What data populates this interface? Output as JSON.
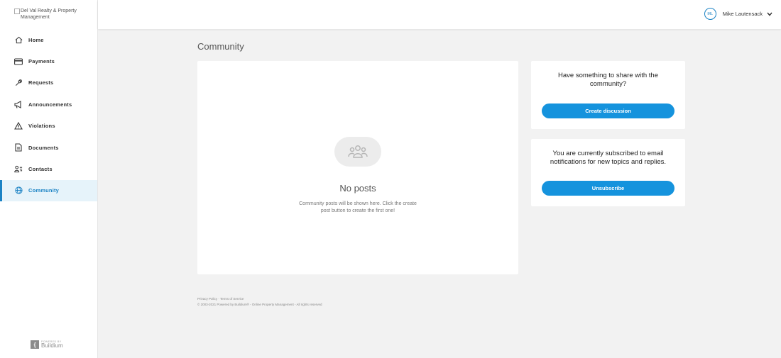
{
  "sidebar": {
    "logo_alt": "Del Val Realty & Property Management",
    "items": [
      {
        "label": "Home"
      },
      {
        "label": "Payments"
      },
      {
        "label": "Requests"
      },
      {
        "label": "Announcements"
      },
      {
        "label": "Violations"
      },
      {
        "label": "Documents"
      },
      {
        "label": "Contacts"
      },
      {
        "label": "Community",
        "active": true
      }
    ],
    "powered_small": "POWERED BY",
    "powered_brand": "Buildium"
  },
  "header": {
    "user_initials": "ML",
    "user_name": "Mike Lautensack"
  },
  "main": {
    "title": "Community",
    "empty_title": "No posts",
    "empty_desc": "Community posts will be shown here. Click the create post button to create the first one!"
  },
  "share_card": {
    "message": "Have something to share with the community?",
    "button": "Create discussion"
  },
  "subscribe_card": {
    "message": "You are currently subscribed to email notifications for new topics and replies.",
    "button": "Unsubscribe"
  },
  "footer": {
    "links": "Privacy Policy · Terms of Service",
    "copyright": "© 2003-2021 Powered by Buildium® - Online Property Management - All rights reserved"
  },
  "colors": {
    "accent": "#1593dd",
    "active_bg": "#e6f3fa",
    "background": "#f2f2f2"
  }
}
